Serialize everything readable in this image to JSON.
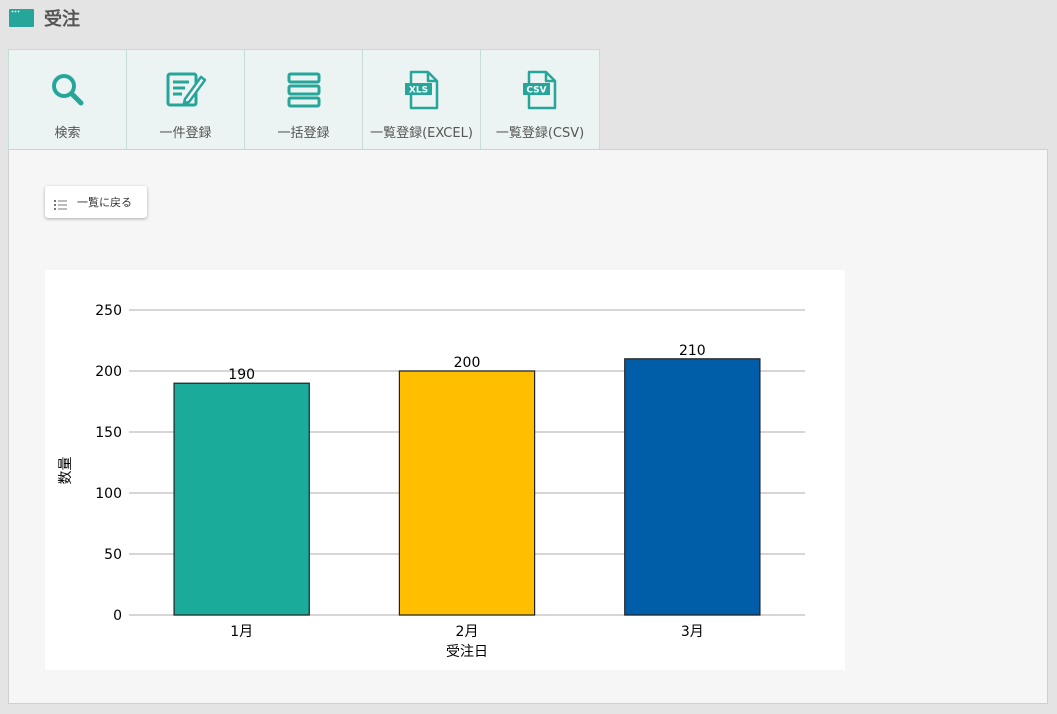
{
  "header": {
    "title": "受注",
    "icon": "window-icon"
  },
  "toolbar": {
    "items": [
      {
        "label": "検索",
        "icon": "search-icon"
      },
      {
        "label": "一件登録",
        "icon": "edit-document-icon"
      },
      {
        "label": "一括登録",
        "icon": "stacked-list-icon"
      },
      {
        "label": "一覧登録(EXCEL)",
        "icon": "xls-file-icon",
        "badge": "XLS"
      },
      {
        "label": "一覧登録(CSV)",
        "icon": "csv-file-icon",
        "badge": "CSV"
      }
    ]
  },
  "back_button": {
    "label": "一覧に戻る",
    "icon": "list-icon"
  },
  "colors": {
    "accent": "#26a69a",
    "gridline": "#c8c8c8"
  },
  "chart_data": {
    "type": "bar",
    "categories": [
      "1月",
      "2月",
      "3月"
    ],
    "values": [
      190,
      200,
      210
    ],
    "colors": [
      "#1aab9b",
      "#ffbf00",
      "#005ea8"
    ],
    "xlabel": "受注日",
    "ylabel": "数量",
    "ylim": [
      0,
      250
    ],
    "yticks": [
      0,
      50,
      100,
      150,
      200,
      250
    ],
    "data_labels": true,
    "grid": true
  }
}
